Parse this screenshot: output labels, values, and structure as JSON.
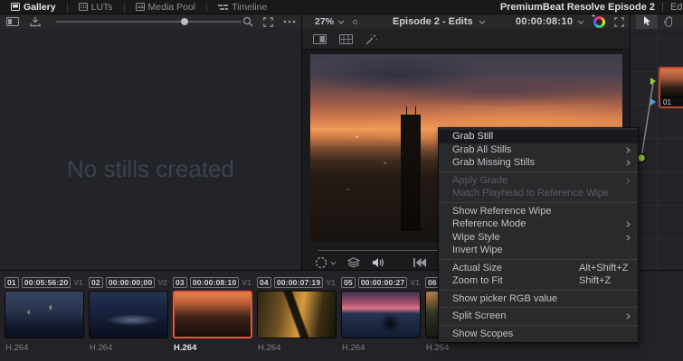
{
  "topbar": {
    "tabs": [
      {
        "label": "Gallery"
      },
      {
        "label": "LUTs"
      },
      {
        "label": "Media Pool"
      },
      {
        "label": "Timeline"
      }
    ],
    "project_title": "PremiumBeat Resolve Episode 2",
    "clipped_right_text": "Edit"
  },
  "gallery": {
    "empty_message": "No stills created"
  },
  "viewer": {
    "zoom_level": "27%",
    "timeline_name": "Episode 2 - Edits",
    "timecode": "00:00:08:10"
  },
  "node_graph": {
    "node_label": "01"
  },
  "context_menu": {
    "items": [
      {
        "label": "Grab Still",
        "state": "hovered"
      },
      {
        "label": "Grab All Stills",
        "submenu": true
      },
      {
        "label": "Grab Missing Stills",
        "submenu": true
      },
      {
        "label": "Apply Grade",
        "submenu": true,
        "disabled": true
      },
      {
        "label": "Match Playhead to Reference Wipe",
        "disabled": true
      },
      {
        "label": "Show Reference Wipe"
      },
      {
        "label": "Reference Mode",
        "submenu": true
      },
      {
        "label": "Wipe Style",
        "submenu": true
      },
      {
        "label": "Invert Wipe"
      },
      {
        "label": "Actual Size",
        "shortcut": "Alt+Shift+Z"
      },
      {
        "label": "Zoom to Fit",
        "shortcut": "Shift+Z"
      },
      {
        "label": "Show picker RGB value"
      },
      {
        "label": "Split Screen",
        "submenu": true
      },
      {
        "label": "Show Scopes"
      }
    ]
  },
  "timeline": {
    "clips": [
      {
        "number": "01",
        "timecode": "00:05:56:20",
        "track": "V1",
        "codec": "H.264"
      },
      {
        "number": "02",
        "timecode": "00:00:00;00",
        "track": "V2",
        "codec": "H.264"
      },
      {
        "number": "03",
        "timecode": "00:00:08:10",
        "track": "V1",
        "codec": "H.264",
        "selected": true
      },
      {
        "number": "04",
        "timecode": "00:00:07:19",
        "track": "V1",
        "codec": "H.264"
      },
      {
        "number": "05",
        "timecode": "00:00:00:27",
        "track": "V1",
        "codec": "H.264"
      },
      {
        "number": "06",
        "codec": "H.264"
      }
    ]
  },
  "colors": {
    "selection_accent": "#e4553a",
    "node_output_green": "#9ccd3c",
    "node_input_blue": "#3fa9e0"
  }
}
